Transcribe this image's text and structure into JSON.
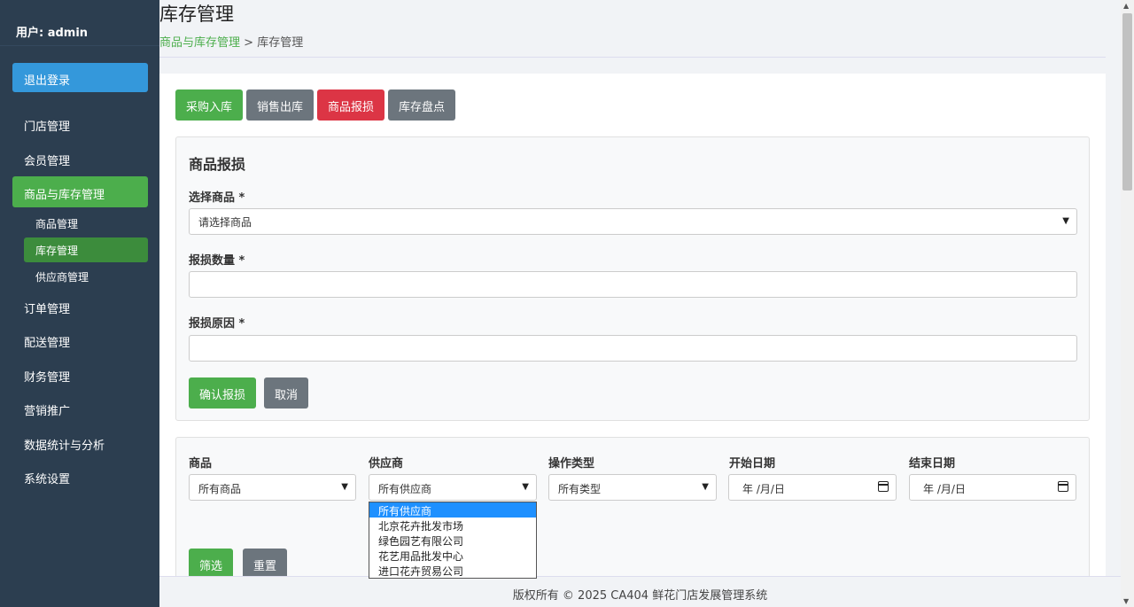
{
  "sidebar": {
    "user_label": "用户: admin",
    "logout_label": "退出登录",
    "items": [
      {
        "label": "门店管理"
      },
      {
        "label": "会员管理"
      },
      {
        "label": "商品与库存管理"
      },
      {
        "label": "订单管理"
      },
      {
        "label": "配送管理"
      },
      {
        "label": "财务管理"
      },
      {
        "label": "营销推广"
      },
      {
        "label": "数据统计与分析"
      },
      {
        "label": "系统设置"
      }
    ],
    "sub_items": [
      {
        "label": "商品管理"
      },
      {
        "label": "库存管理"
      },
      {
        "label": "供应商管理"
      }
    ]
  },
  "header": {
    "title": "库存管理",
    "breadcrumb_link": "商品与库存管理",
    "breadcrumb_sep": ">",
    "breadcrumb_current": "库存管理"
  },
  "tabs": [
    {
      "label": "采购入库",
      "color": "#4cae4c"
    },
    {
      "label": "销售出库",
      "color": "#6c757d"
    },
    {
      "label": "商品报损",
      "color": "#dc3545"
    },
    {
      "label": "库存盘点",
      "color": "#6c757d"
    }
  ],
  "form": {
    "title": "商品报损",
    "product_label": "选择商品 *",
    "product_value": "请选择商品",
    "quantity_label": "报损数量 *",
    "quantity_value": "",
    "reason_label": "报损原因 *",
    "reason_value": "",
    "confirm_label": "确认报损",
    "cancel_label": "取消"
  },
  "filter": {
    "product_label": "商品",
    "product_value": "所有商品",
    "supplier_label": "供应商",
    "supplier_value": "所有供应商",
    "type_label": "操作类型",
    "type_value": "所有类型",
    "start_label": "开始日期",
    "start_value": "年 /月/日",
    "end_label": "结束日期",
    "end_value": "年 /月/日",
    "apply_label": "筛选",
    "reset_label": "重置",
    "supplier_options": [
      "所有供应商",
      "北京花卉批发市场",
      "绿色园艺有限公司",
      "花艺用品批发中心",
      "进口花卉贸易公司"
    ]
  },
  "footer": {
    "text": "版权所有 © 2025 CA404 鲜花门店发展管理系统"
  },
  "colors": {
    "sidebar_bg": "#2c3e50",
    "accent_green": "#4cae4c",
    "accent_blue": "#3498db",
    "danger_red": "#dc3545"
  }
}
